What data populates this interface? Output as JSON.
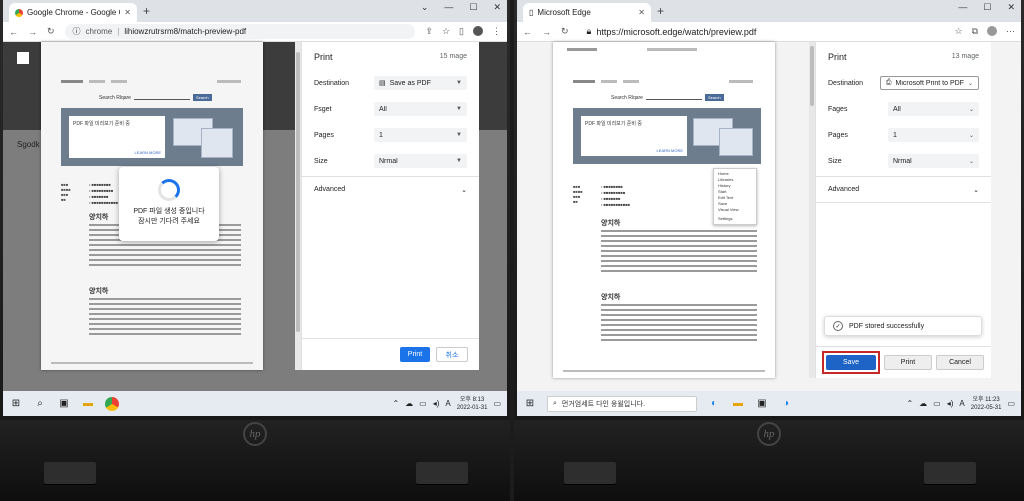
{
  "chrome": {
    "tab_title": "Google Chrome - Google Chr",
    "url_scheme": "chrome",
    "url_path": "lihiowzrutrsrm8/match-preview-pdf",
    "page_side_text": "Sgodk",
    "print": {
      "title": "Print",
      "page_count": "15 mage",
      "destination_label": "Destination",
      "destination_value": "Save as PDF",
      "fsget_label": "Fsget",
      "fsget_value": "All",
      "pages_label": "Pages",
      "pages_value": "1",
      "size_label": "Size",
      "size_value": "Nrmal",
      "advanced_label": "Advanced",
      "print_button": "Print",
      "cancel_button": "취소"
    },
    "loading_line1": "PDF 파일 생성 중입니다",
    "loading_line2": "잠시만 기다려 주세요",
    "preview": {
      "search_label": "Search Rlqare",
      "search_button": "Search",
      "hero_text": "PDF 파일 미리보기 준비 중",
      "hero_more": "LEARN MORE",
      "heading1": "양치하",
      "heading2": "양치하"
    },
    "taskbar": {
      "clock_time": "오후 8:13",
      "clock_date": "2022-01-31"
    }
  },
  "edge": {
    "tab_title": "Microsoft Edge",
    "url": "https://microsoft.edge/watch/preview.pdf",
    "print": {
      "title": "Print",
      "page_count": "13 mage",
      "destination_label": "Destination",
      "destination_value": "Microsoft Print to PDF",
      "fages_label": "Fages",
      "fages_value": "All",
      "pages_label": "Pages",
      "pages_value": "1",
      "size_label": "Size",
      "size_value": "Nrmal",
      "advanced_label": "Advanced",
      "toast": "PDF stored successfully",
      "save_button": "Save",
      "print_button": "Print",
      "cancel_button": "Cancel"
    },
    "preview": {
      "search_label": "Search Rlqare",
      "search_button": "Search",
      "hero_text": "PDF 파일 미리보기 준비 중",
      "hero_more": "LEARN MORE",
      "heading1": "양치하",
      "heading2": "양치하"
    },
    "context_menu": [
      "Home",
      "Libraries",
      "History",
      "Start",
      "Edit Text",
      "Save",
      "Visual View",
      "Settings"
    ],
    "taskbar": {
      "search_placeholder": "먼거엄세트 다인 웅윌입니다.",
      "clock_time": "오후 11:23",
      "clock_date": "2022-05-31"
    }
  },
  "colors": {
    "accent_blue": "#1a73e8",
    "edge_save_blue": "#1e63c6",
    "highlight_red": "#c62828"
  }
}
